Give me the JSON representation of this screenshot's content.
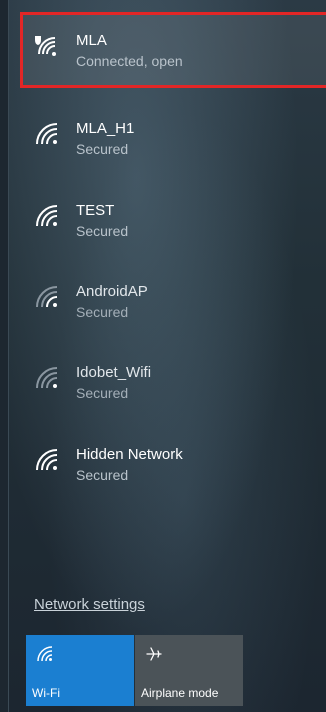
{
  "networks": [
    {
      "name": "MLA",
      "status": "Connected, open",
      "icon": "wifi-open-shield-icon",
      "selected": true
    },
    {
      "name": "MLA_H1",
      "status": "Secured",
      "icon": "wifi-icon"
    },
    {
      "name": "TEST",
      "status": "Secured",
      "icon": "wifi-icon"
    },
    {
      "name": "AndroidAP",
      "status": "Secured",
      "icon": "wifi-weak-icon"
    },
    {
      "name": "Idobet_Wifi",
      "status": "Secured",
      "icon": "wifi-weak-icon"
    },
    {
      "name": "Hidden Network",
      "status": "Secured",
      "icon": "wifi-icon"
    }
  ],
  "footer": {
    "settings_link": "Network settings"
  },
  "tiles": {
    "wifi": {
      "label": "Wi-Fi",
      "icon": "wifi-icon",
      "active": true
    },
    "airplane": {
      "label": "Airplane mode",
      "icon": "airplane-icon",
      "active": false
    }
  },
  "colors": {
    "accent": "#1b7fd1",
    "selection_border": "#e32626",
    "tile_inactive": "#4b5358"
  }
}
